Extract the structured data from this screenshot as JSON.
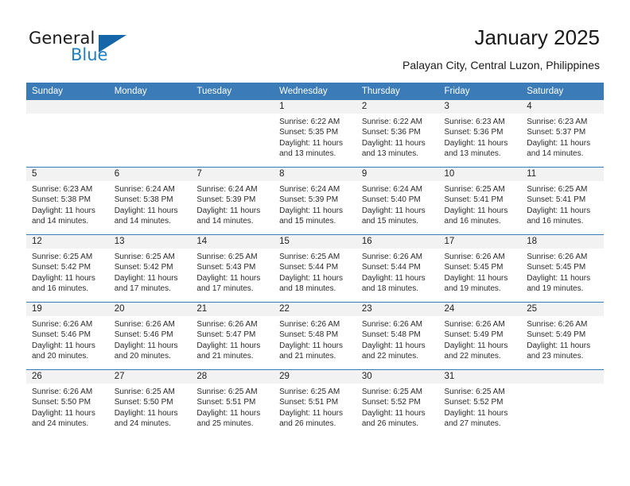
{
  "brand": {
    "line1": "General",
    "line2": "Blue",
    "accent": "#1f7fc4",
    "triangle_color": "#1566a8"
  },
  "header": {
    "title": "January 2025",
    "subtitle": "Palayan City, Central Luzon, Philippines"
  },
  "theme": {
    "header_blue": "#3b7cb8",
    "daynum_gray": "#f2f2f2",
    "text": "#222222"
  },
  "weekday_headers": [
    "Sunday",
    "Monday",
    "Tuesday",
    "Wednesday",
    "Thursday",
    "Friday",
    "Saturday"
  ],
  "weeks": [
    [
      {
        "day": "",
        "lines": []
      },
      {
        "day": "",
        "lines": []
      },
      {
        "day": "",
        "lines": []
      },
      {
        "day": "1",
        "lines": [
          "Sunrise: 6:22 AM",
          "Sunset: 5:35 PM",
          "Daylight: 11 hours",
          "and 13 minutes."
        ]
      },
      {
        "day": "2",
        "lines": [
          "Sunrise: 6:22 AM",
          "Sunset: 5:36 PM",
          "Daylight: 11 hours",
          "and 13 minutes."
        ]
      },
      {
        "day": "3",
        "lines": [
          "Sunrise: 6:23 AM",
          "Sunset: 5:36 PM",
          "Daylight: 11 hours",
          "and 13 minutes."
        ]
      },
      {
        "day": "4",
        "lines": [
          "Sunrise: 6:23 AM",
          "Sunset: 5:37 PM",
          "Daylight: 11 hours",
          "and 14 minutes."
        ]
      }
    ],
    [
      {
        "day": "5",
        "lines": [
          "Sunrise: 6:23 AM",
          "Sunset: 5:38 PM",
          "Daylight: 11 hours",
          "and 14 minutes."
        ]
      },
      {
        "day": "6",
        "lines": [
          "Sunrise: 6:24 AM",
          "Sunset: 5:38 PM",
          "Daylight: 11 hours",
          "and 14 minutes."
        ]
      },
      {
        "day": "7",
        "lines": [
          "Sunrise: 6:24 AM",
          "Sunset: 5:39 PM",
          "Daylight: 11 hours",
          "and 14 minutes."
        ]
      },
      {
        "day": "8",
        "lines": [
          "Sunrise: 6:24 AM",
          "Sunset: 5:39 PM",
          "Daylight: 11 hours",
          "and 15 minutes."
        ]
      },
      {
        "day": "9",
        "lines": [
          "Sunrise: 6:24 AM",
          "Sunset: 5:40 PM",
          "Daylight: 11 hours",
          "and 15 minutes."
        ]
      },
      {
        "day": "10",
        "lines": [
          "Sunrise: 6:25 AM",
          "Sunset: 5:41 PM",
          "Daylight: 11 hours",
          "and 16 minutes."
        ]
      },
      {
        "day": "11",
        "lines": [
          "Sunrise: 6:25 AM",
          "Sunset: 5:41 PM",
          "Daylight: 11 hours",
          "and 16 minutes."
        ]
      }
    ],
    [
      {
        "day": "12",
        "lines": [
          "Sunrise: 6:25 AM",
          "Sunset: 5:42 PM",
          "Daylight: 11 hours",
          "and 16 minutes."
        ]
      },
      {
        "day": "13",
        "lines": [
          "Sunrise: 6:25 AM",
          "Sunset: 5:42 PM",
          "Daylight: 11 hours",
          "and 17 minutes."
        ]
      },
      {
        "day": "14",
        "lines": [
          "Sunrise: 6:25 AM",
          "Sunset: 5:43 PM",
          "Daylight: 11 hours",
          "and 17 minutes."
        ]
      },
      {
        "day": "15",
        "lines": [
          "Sunrise: 6:25 AM",
          "Sunset: 5:44 PM",
          "Daylight: 11 hours",
          "and 18 minutes."
        ]
      },
      {
        "day": "16",
        "lines": [
          "Sunrise: 6:26 AM",
          "Sunset: 5:44 PM",
          "Daylight: 11 hours",
          "and 18 minutes."
        ]
      },
      {
        "day": "17",
        "lines": [
          "Sunrise: 6:26 AM",
          "Sunset: 5:45 PM",
          "Daylight: 11 hours",
          "and 19 minutes."
        ]
      },
      {
        "day": "18",
        "lines": [
          "Sunrise: 6:26 AM",
          "Sunset: 5:45 PM",
          "Daylight: 11 hours",
          "and 19 minutes."
        ]
      }
    ],
    [
      {
        "day": "19",
        "lines": [
          "Sunrise: 6:26 AM",
          "Sunset: 5:46 PM",
          "Daylight: 11 hours",
          "and 20 minutes."
        ]
      },
      {
        "day": "20",
        "lines": [
          "Sunrise: 6:26 AM",
          "Sunset: 5:46 PM",
          "Daylight: 11 hours",
          "and 20 minutes."
        ]
      },
      {
        "day": "21",
        "lines": [
          "Sunrise: 6:26 AM",
          "Sunset: 5:47 PM",
          "Daylight: 11 hours",
          "and 21 minutes."
        ]
      },
      {
        "day": "22",
        "lines": [
          "Sunrise: 6:26 AM",
          "Sunset: 5:48 PM",
          "Daylight: 11 hours",
          "and 21 minutes."
        ]
      },
      {
        "day": "23",
        "lines": [
          "Sunrise: 6:26 AM",
          "Sunset: 5:48 PM",
          "Daylight: 11 hours",
          "and 22 minutes."
        ]
      },
      {
        "day": "24",
        "lines": [
          "Sunrise: 6:26 AM",
          "Sunset: 5:49 PM",
          "Daylight: 11 hours",
          "and 22 minutes."
        ]
      },
      {
        "day": "25",
        "lines": [
          "Sunrise: 6:26 AM",
          "Sunset: 5:49 PM",
          "Daylight: 11 hours",
          "and 23 minutes."
        ]
      }
    ],
    [
      {
        "day": "26",
        "lines": [
          "Sunrise: 6:26 AM",
          "Sunset: 5:50 PM",
          "Daylight: 11 hours",
          "and 24 minutes."
        ]
      },
      {
        "day": "27",
        "lines": [
          "Sunrise: 6:25 AM",
          "Sunset: 5:50 PM",
          "Daylight: 11 hours",
          "and 24 minutes."
        ]
      },
      {
        "day": "28",
        "lines": [
          "Sunrise: 6:25 AM",
          "Sunset: 5:51 PM",
          "Daylight: 11 hours",
          "and 25 minutes."
        ]
      },
      {
        "day": "29",
        "lines": [
          "Sunrise: 6:25 AM",
          "Sunset: 5:51 PM",
          "Daylight: 11 hours",
          "and 26 minutes."
        ]
      },
      {
        "day": "30",
        "lines": [
          "Sunrise: 6:25 AM",
          "Sunset: 5:52 PM",
          "Daylight: 11 hours",
          "and 26 minutes."
        ]
      },
      {
        "day": "31",
        "lines": [
          "Sunrise: 6:25 AM",
          "Sunset: 5:52 PM",
          "Daylight: 11 hours",
          "and 27 minutes."
        ]
      },
      {
        "day": "",
        "lines": []
      }
    ]
  ]
}
